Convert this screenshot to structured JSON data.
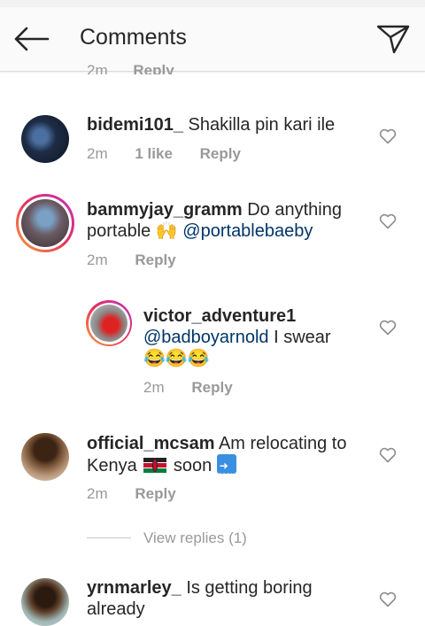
{
  "header": {
    "title": "Comments",
    "back_icon": "arrow-left-icon",
    "send_icon": "paper-plane-icon"
  },
  "previous": {
    "time": "2m",
    "reply": "Reply"
  },
  "comments": [
    {
      "user": "bidemi101_",
      "text": "Shakilla pin kari ile",
      "time": "2m",
      "likes": "1 like",
      "reply": "Reply"
    },
    {
      "user": "bammyjay_gramm",
      "text": "Do anything portable 🙌",
      "mention": "@portablebaeby",
      "time": "2m",
      "reply": "Reply"
    },
    {
      "user": "victor_adventure1",
      "mention": "@badboyarnold",
      "text": "I swear",
      "emoji": "😂😂😂",
      "time": "2m",
      "reply": "Reply"
    },
    {
      "user": "official_mcsam",
      "text": "Am relocating to",
      "text2": "Kenya",
      "text3": "soon",
      "soon_label": "SOON",
      "time": "2m",
      "reply": "Reply"
    },
    {
      "user": "yrnmarley_",
      "text": "Is getting boring already"
    }
  ],
  "view_replies": "View replies (1)",
  "colors": {
    "mention": "#003569",
    "meta": "#999999",
    "story_ring": "#e6315a"
  }
}
